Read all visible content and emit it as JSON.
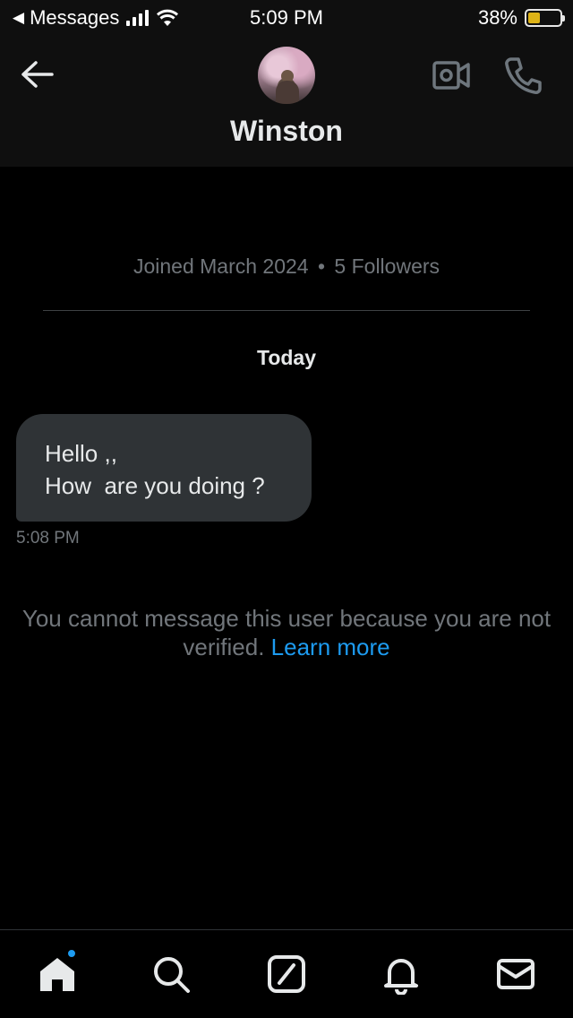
{
  "status_bar": {
    "back_app": "Messages",
    "time": "5:09 PM",
    "battery_percent": "38%",
    "battery_level": 0.38
  },
  "header": {
    "name": "Winston"
  },
  "conversation": {
    "joined_date": "Joined March 2024",
    "separator": "•",
    "followers": "5 Followers",
    "day_label": "Today",
    "messages": [
      {
        "text": "Hello ,,\nHow  are you doing ?",
        "time": "5:08 PM"
      }
    ],
    "notice_text": "You cannot message this user because you are not verified.",
    "learn_more": "Learn more"
  },
  "colors": {
    "accent": "#1d9bf0",
    "bubble": "#2f3336",
    "muted_text": "#71767b",
    "battery": "#f5c518"
  },
  "icons": [
    "back-arrow-icon",
    "video-call-icon",
    "phone-call-icon",
    "home-icon",
    "search-icon",
    "grok-icon",
    "notifications-icon",
    "messages-icon"
  ]
}
